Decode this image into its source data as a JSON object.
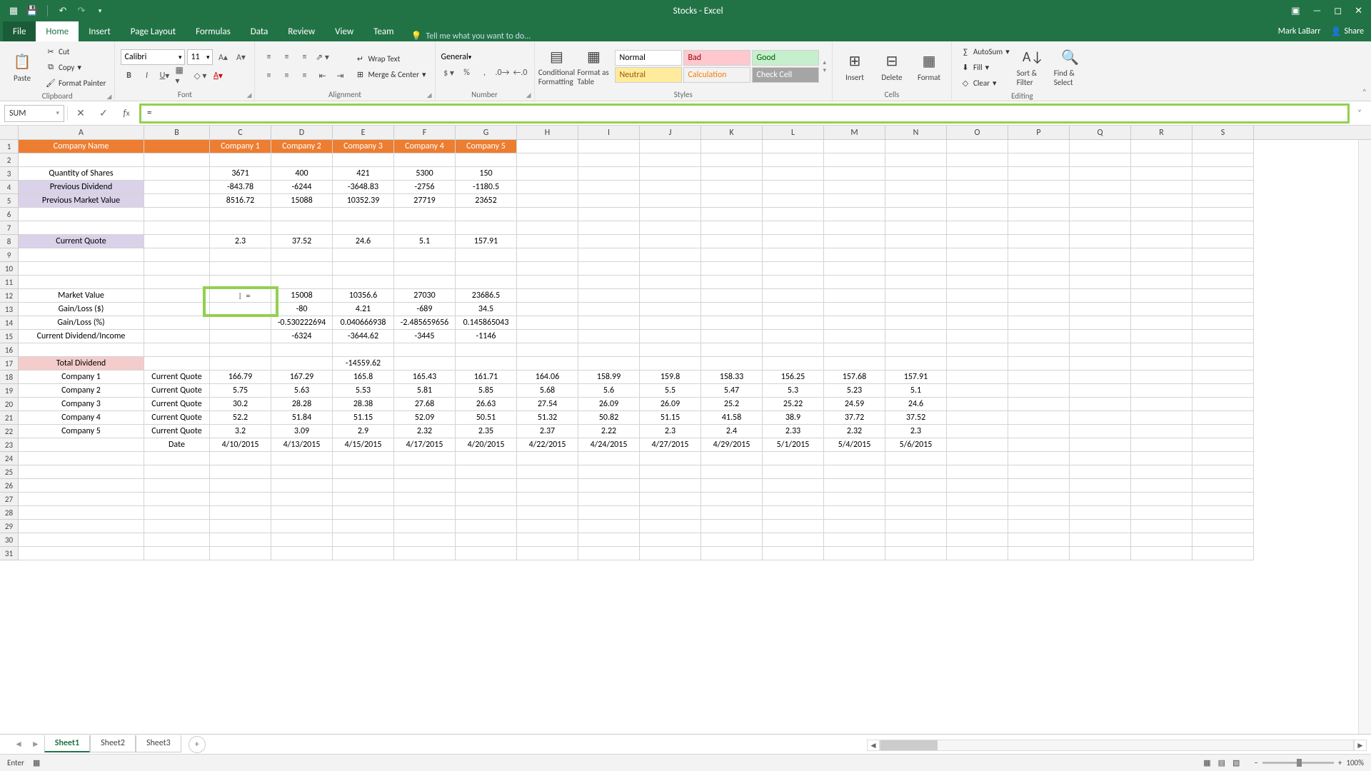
{
  "title": "Stocks - Excel",
  "user": "Mark LaBarr",
  "share": "Share",
  "tabs": [
    "File",
    "Home",
    "Insert",
    "Page Layout",
    "Formulas",
    "Data",
    "Review",
    "View",
    "Team"
  ],
  "activeTab": "Home",
  "tellme": "Tell me what you want to do...",
  "ribbon": {
    "clipboard": {
      "label": "Clipboard",
      "paste": "Paste",
      "cut": "Cut",
      "copy": "Copy",
      "fmtpainter": "Format Painter"
    },
    "font": {
      "label": "Font",
      "name": "Calibri",
      "size": "11"
    },
    "alignment": {
      "label": "Alignment",
      "wrap": "Wrap Text",
      "merge": "Merge & Center"
    },
    "number": {
      "label": "Number",
      "format": "General"
    },
    "styles": {
      "label": "Styles",
      "cond": "Conditional Formatting",
      "fat": "Format as Table",
      "normal": "Normal",
      "bad": "Bad",
      "good": "Good",
      "neutral": "Neutral",
      "calc": "Calculation",
      "check": "Check Cell"
    },
    "cells": {
      "label": "Cells",
      "insert": "Insert",
      "delete": "Delete",
      "format": "Format"
    },
    "editing": {
      "label": "Editing",
      "autosum": "AutoSum",
      "fill": "Fill",
      "clear": "Clear",
      "sort": "Sort & Filter",
      "find": "Find & Select"
    }
  },
  "formulaBar": {
    "nameBox": "SUM",
    "formula": "="
  },
  "columns": [
    "A",
    "B",
    "C",
    "D",
    "E",
    "F",
    "G",
    "H",
    "I",
    "J",
    "K",
    "L",
    "M",
    "N",
    "O",
    "P",
    "Q",
    "R",
    "S"
  ],
  "colWidths": {
    "A": 176,
    "B": 92,
    "default": 86
  },
  "activeCellInput": "=",
  "rows": [
    {
      "n": 1,
      "cells": {
        "A": {
          "v": "Company Name",
          "c": "hdr-orange center"
        },
        "B": {
          "v": "",
          "c": "hdr-orange"
        },
        "C": {
          "v": "Company 1",
          "c": "hdr-orange center"
        },
        "D": {
          "v": "Company 2",
          "c": "hdr-orange center"
        },
        "E": {
          "v": "Company 3",
          "c": "hdr-orange center"
        },
        "F": {
          "v": "Company 4",
          "c": "hdr-orange center"
        },
        "G": {
          "v": "Company 5",
          "c": "hdr-orange center"
        }
      }
    },
    {
      "n": 2,
      "cells": {}
    },
    {
      "n": 3,
      "cells": {
        "A": {
          "v": "Quantity of Shares",
          "c": "center"
        },
        "C": {
          "v": "3671",
          "c": "center"
        },
        "D": {
          "v": "400",
          "c": "center"
        },
        "E": {
          "v": "421",
          "c": "center"
        },
        "F": {
          "v": "5300",
          "c": "center"
        },
        "G": {
          "v": "150",
          "c": "center"
        }
      }
    },
    {
      "n": 4,
      "cells": {
        "A": {
          "v": "Previous Dividend",
          "c": "hdr-purple center"
        },
        "C": {
          "v": "-843.78",
          "c": "center"
        },
        "D": {
          "v": "-6244",
          "c": "center"
        },
        "E": {
          "v": "-3648.83",
          "c": "center"
        },
        "F": {
          "v": "-2756",
          "c": "center"
        },
        "G": {
          "v": "-1180.5",
          "c": "center"
        }
      }
    },
    {
      "n": 5,
      "cells": {
        "A": {
          "v": "Previous Market Value",
          "c": "hdr-purple center"
        },
        "C": {
          "v": "8516.72",
          "c": "center"
        },
        "D": {
          "v": "15088",
          "c": "center"
        },
        "E": {
          "v": "10352.39",
          "c": "center"
        },
        "F": {
          "v": "27719",
          "c": "center"
        },
        "G": {
          "v": "23652",
          "c": "center"
        }
      }
    },
    {
      "n": 6,
      "cells": {}
    },
    {
      "n": 7,
      "cells": {}
    },
    {
      "n": 8,
      "cells": {
        "A": {
          "v": "Current Quote",
          "c": "hdr-purple center"
        },
        "C": {
          "v": "2.3",
          "c": "center"
        },
        "D": {
          "v": "37.52",
          "c": "center"
        },
        "E": {
          "v": "24.6",
          "c": "center"
        },
        "F": {
          "v": "5.1",
          "c": "center"
        },
        "G": {
          "v": "157.91",
          "c": "center"
        }
      }
    },
    {
      "n": 9,
      "cells": {}
    },
    {
      "n": 10,
      "cells": {}
    },
    {
      "n": 11,
      "cells": {}
    },
    {
      "n": 12,
      "cells": {
        "A": {
          "v": "Market Value",
          "c": "center"
        },
        "D": {
          "v": "15008",
          "c": "center"
        },
        "E": {
          "v": "10356.6",
          "c": "center"
        },
        "F": {
          "v": "27030",
          "c": "center"
        },
        "G": {
          "v": "23686.5",
          "c": "center"
        }
      }
    },
    {
      "n": 13,
      "cells": {
        "A": {
          "v": "Gain/Loss ($)",
          "c": "center"
        },
        "D": {
          "v": "-80",
          "c": "center"
        },
        "E": {
          "v": "4.21",
          "c": "center"
        },
        "F": {
          "v": "-689",
          "c": "center"
        },
        "G": {
          "v": "34.5",
          "c": "center"
        }
      }
    },
    {
      "n": 14,
      "cells": {
        "A": {
          "v": "Gain/Loss (%)",
          "c": "center"
        },
        "D": {
          "v": "-0.530222694",
          "c": "center"
        },
        "E": {
          "v": "0.040666938",
          "c": "center"
        },
        "F": {
          "v": "-2.485659656",
          "c": "center"
        },
        "G": {
          "v": "0.145865043",
          "c": "center"
        }
      }
    },
    {
      "n": 15,
      "cells": {
        "A": {
          "v": "Current Dividend/Income",
          "c": "center"
        },
        "D": {
          "v": "-6324",
          "c": "center"
        },
        "E": {
          "v": "-3644.62",
          "c": "center"
        },
        "F": {
          "v": "-3445",
          "c": "center"
        },
        "G": {
          "v": "-1146",
          "c": "center"
        }
      }
    },
    {
      "n": 16,
      "cells": {}
    },
    {
      "n": 17,
      "cells": {
        "A": {
          "v": "Total Dividend",
          "c": "hdr-pink center"
        },
        "E": {
          "v": "-14559.62",
          "c": "center"
        }
      }
    },
    {
      "n": 18,
      "cells": {
        "A": {
          "v": "Company 1",
          "c": "center"
        },
        "B": {
          "v": "Current Quote",
          "c": "center"
        },
        "C": {
          "v": "166.79",
          "c": "center"
        },
        "D": {
          "v": "167.29",
          "c": "center"
        },
        "E": {
          "v": "165.8",
          "c": "center"
        },
        "F": {
          "v": "165.43",
          "c": "center"
        },
        "G": {
          "v": "161.71",
          "c": "center"
        },
        "H": {
          "v": "164.06",
          "c": "center"
        },
        "I": {
          "v": "158.99",
          "c": "center"
        },
        "J": {
          "v": "159.8",
          "c": "center"
        },
        "K": {
          "v": "158.33",
          "c": "center"
        },
        "L": {
          "v": "156.25",
          "c": "center"
        },
        "M": {
          "v": "157.68",
          "c": "center"
        },
        "N": {
          "v": "157.91",
          "c": "center"
        }
      }
    },
    {
      "n": 19,
      "cells": {
        "A": {
          "v": "Company 2",
          "c": "center"
        },
        "B": {
          "v": "Current Quote",
          "c": "center"
        },
        "C": {
          "v": "5.75",
          "c": "center"
        },
        "D": {
          "v": "5.63",
          "c": "center"
        },
        "E": {
          "v": "5.53",
          "c": "center"
        },
        "F": {
          "v": "5.81",
          "c": "center"
        },
        "G": {
          "v": "5.85",
          "c": "center"
        },
        "H": {
          "v": "5.68",
          "c": "center"
        },
        "I": {
          "v": "5.6",
          "c": "center"
        },
        "J": {
          "v": "5.5",
          "c": "center"
        },
        "K": {
          "v": "5.47",
          "c": "center"
        },
        "L": {
          "v": "5.3",
          "c": "center"
        },
        "M": {
          "v": "5.23",
          "c": "center"
        },
        "N": {
          "v": "5.1",
          "c": "center"
        }
      }
    },
    {
      "n": 20,
      "cells": {
        "A": {
          "v": "Company 3",
          "c": "center"
        },
        "B": {
          "v": "Current Quote",
          "c": "center"
        },
        "C": {
          "v": "30.2",
          "c": "center"
        },
        "D": {
          "v": "28.28",
          "c": "center"
        },
        "E": {
          "v": "28.38",
          "c": "center"
        },
        "F": {
          "v": "27.68",
          "c": "center"
        },
        "G": {
          "v": "26.63",
          "c": "center"
        },
        "H": {
          "v": "27.54",
          "c": "center"
        },
        "I": {
          "v": "26.09",
          "c": "center"
        },
        "J": {
          "v": "26.09",
          "c": "center"
        },
        "K": {
          "v": "25.2",
          "c": "center"
        },
        "L": {
          "v": "25.22",
          "c": "center"
        },
        "M": {
          "v": "24.59",
          "c": "center"
        },
        "N": {
          "v": "24.6",
          "c": "center"
        }
      }
    },
    {
      "n": 21,
      "cells": {
        "A": {
          "v": "Company 4",
          "c": "center"
        },
        "B": {
          "v": "Current Quote",
          "c": "center"
        },
        "C": {
          "v": "52.2",
          "c": "center"
        },
        "D": {
          "v": "51.84",
          "c": "center"
        },
        "E": {
          "v": "51.15",
          "c": "center"
        },
        "F": {
          "v": "52.09",
          "c": "center"
        },
        "G": {
          "v": "50.51",
          "c": "center"
        },
        "H": {
          "v": "51.32",
          "c": "center"
        },
        "I": {
          "v": "50.82",
          "c": "center"
        },
        "J": {
          "v": "51.15",
          "c": "center"
        },
        "K": {
          "v": "41.58",
          "c": "center"
        },
        "L": {
          "v": "38.9",
          "c": "center"
        },
        "M": {
          "v": "37.72",
          "c": "center"
        },
        "N": {
          "v": "37.52",
          "c": "center"
        }
      }
    },
    {
      "n": 22,
      "cells": {
        "A": {
          "v": "Company 5",
          "c": "center"
        },
        "B": {
          "v": "Current Quote",
          "c": "center"
        },
        "C": {
          "v": "3.2",
          "c": "center"
        },
        "D": {
          "v": "3.09",
          "c": "center"
        },
        "E": {
          "v": "2.9",
          "c": "center"
        },
        "F": {
          "v": "2.32",
          "c": "center"
        },
        "G": {
          "v": "2.35",
          "c": "center"
        },
        "H": {
          "v": "2.37",
          "c": "center"
        },
        "I": {
          "v": "2.22",
          "c": "center"
        },
        "J": {
          "v": "2.3",
          "c": "center"
        },
        "K": {
          "v": "2.4",
          "c": "center"
        },
        "L": {
          "v": "2.33",
          "c": "center"
        },
        "M": {
          "v": "2.32",
          "c": "center"
        },
        "N": {
          "v": "2.3",
          "c": "center"
        }
      }
    },
    {
      "n": 23,
      "cells": {
        "B": {
          "v": "Date",
          "c": "center"
        },
        "C": {
          "v": "4/10/2015",
          "c": "center"
        },
        "D": {
          "v": "4/13/2015",
          "c": "center"
        },
        "E": {
          "v": "4/15/2015",
          "c": "center"
        },
        "F": {
          "v": "4/17/2015",
          "c": "center"
        },
        "G": {
          "v": "4/20/2015",
          "c": "center"
        },
        "H": {
          "v": "4/22/2015",
          "c": "center"
        },
        "I": {
          "v": "4/24/2015",
          "c": "center"
        },
        "J": {
          "v": "4/27/2015",
          "c": "center"
        },
        "K": {
          "v": "4/29/2015",
          "c": "center"
        },
        "L": {
          "v": "5/1/2015",
          "c": "center"
        },
        "M": {
          "v": "5/4/2015",
          "c": "center"
        },
        "N": {
          "v": "5/6/2015",
          "c": "center"
        }
      }
    },
    {
      "n": 24,
      "cells": {}
    },
    {
      "n": 25,
      "cells": {}
    },
    {
      "n": 26,
      "cells": {}
    },
    {
      "n": 27,
      "cells": {}
    },
    {
      "n": 28,
      "cells": {}
    },
    {
      "n": 29,
      "cells": {}
    },
    {
      "n": 30,
      "cells": {}
    },
    {
      "n": 31,
      "cells": {}
    }
  ],
  "sheetTabs": [
    "Sheet1",
    "Sheet2",
    "Sheet3"
  ],
  "activeSheet": "Sheet1",
  "status": {
    "mode": "Enter",
    "zoom": "100%"
  }
}
